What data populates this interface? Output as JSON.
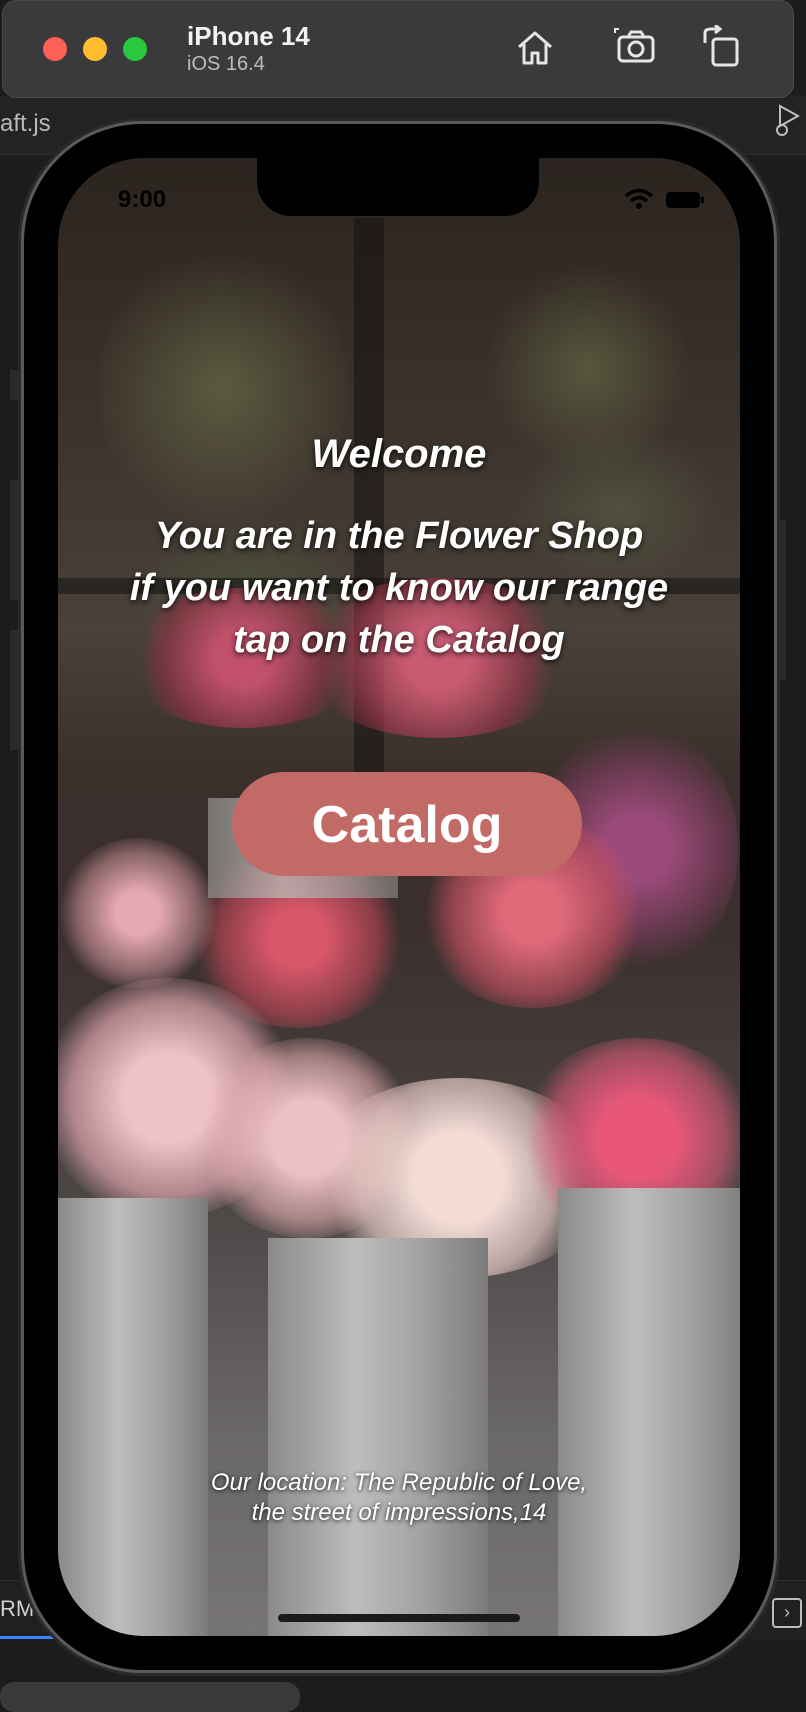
{
  "editor": {
    "tab_label": "aft.js",
    "terminal_tab_label": "RMI"
  },
  "simulator": {
    "device_name": "iPhone 14",
    "os_version": "iOS 16.4",
    "toolbar_icons": [
      "home-icon",
      "screenshot-icon",
      "rotate-icon"
    ]
  },
  "status_bar": {
    "time": "9:00",
    "icons": [
      "wifi-icon",
      "battery-icon"
    ]
  },
  "app": {
    "welcome": "Welcome",
    "intro_lines": [
      "You are in the Flower Shop",
      "if you want to know our range",
      "tap on the Catalog"
    ],
    "catalog_button": "Catalog",
    "location_lines": [
      "Our location: The Republic of Love,",
      "the street of impressions,14"
    ],
    "colors": {
      "button": "#c26a65",
      "text": "#ffffff"
    }
  }
}
